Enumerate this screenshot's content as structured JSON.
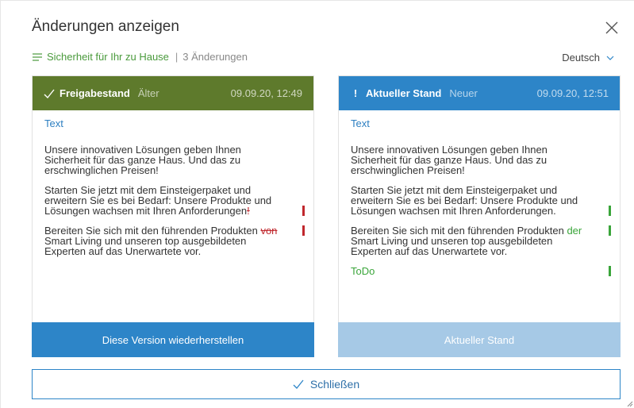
{
  "dialog": {
    "title": "Änderungen anzeigen",
    "document_link": "Sicherheit für Ihr zu Hause",
    "changes_count": "3 Änderungen",
    "language": "Deutsch"
  },
  "left_panel": {
    "name": "Freigabestand",
    "tag": "Älter",
    "date": "09.09.20, 12:49",
    "section_label": "Text",
    "para1": "Unsere innovativen Lösungen geben Ihnen Sicherheit für das ganze Haus. Und das zu erschwinglichen Preisen!",
    "para2": "Starten Sie jetzt mit dem Einsteigerpaket und erweitern Sie es bei Bedarf: Unsere Produkte und Lösungen wachsen mit Ihren Anforderungen",
    "para2_deleted": "!",
    "para3_before": "Bereiten Sie sich mit den führenden Produkten ",
    "para3_deleted": "von",
    "para3_after": " Smart Living und unseren top ausgebildeten Experten auf das Unerwartete vor.",
    "footer_button": "Diese Version wiederherstellen"
  },
  "right_panel": {
    "name": "Aktueller Stand",
    "tag": "Neuer",
    "date": "09.09.20, 12:51",
    "section_label": "Text",
    "para1": "Unsere innovativen Lösungen geben Ihnen Sicherheit für das ganze Haus. Und das zu erschwinglichen Preisen!",
    "para2": "Starten Sie jetzt mit dem Einsteigerpaket und erweitern Sie es bei Bedarf: Unsere Produkte und Lösungen wachsen mit Ihren Anforderungen.",
    "para3_before": "Bereiten Sie sich mit den führenden Produkten ",
    "para3_inserted": "der",
    "para3_after": " Smart Living und unseren top ausgebildeten Experten auf das Unerwartete vor.",
    "todo": "ToDo",
    "footer_button": "Aktueller Stand"
  },
  "close_button": "Schließen",
  "colors": {
    "older_header": "#5e7a2c",
    "newer_header": "#2d85c8",
    "deleted": "#c0272d",
    "inserted": "#3aa53a"
  }
}
